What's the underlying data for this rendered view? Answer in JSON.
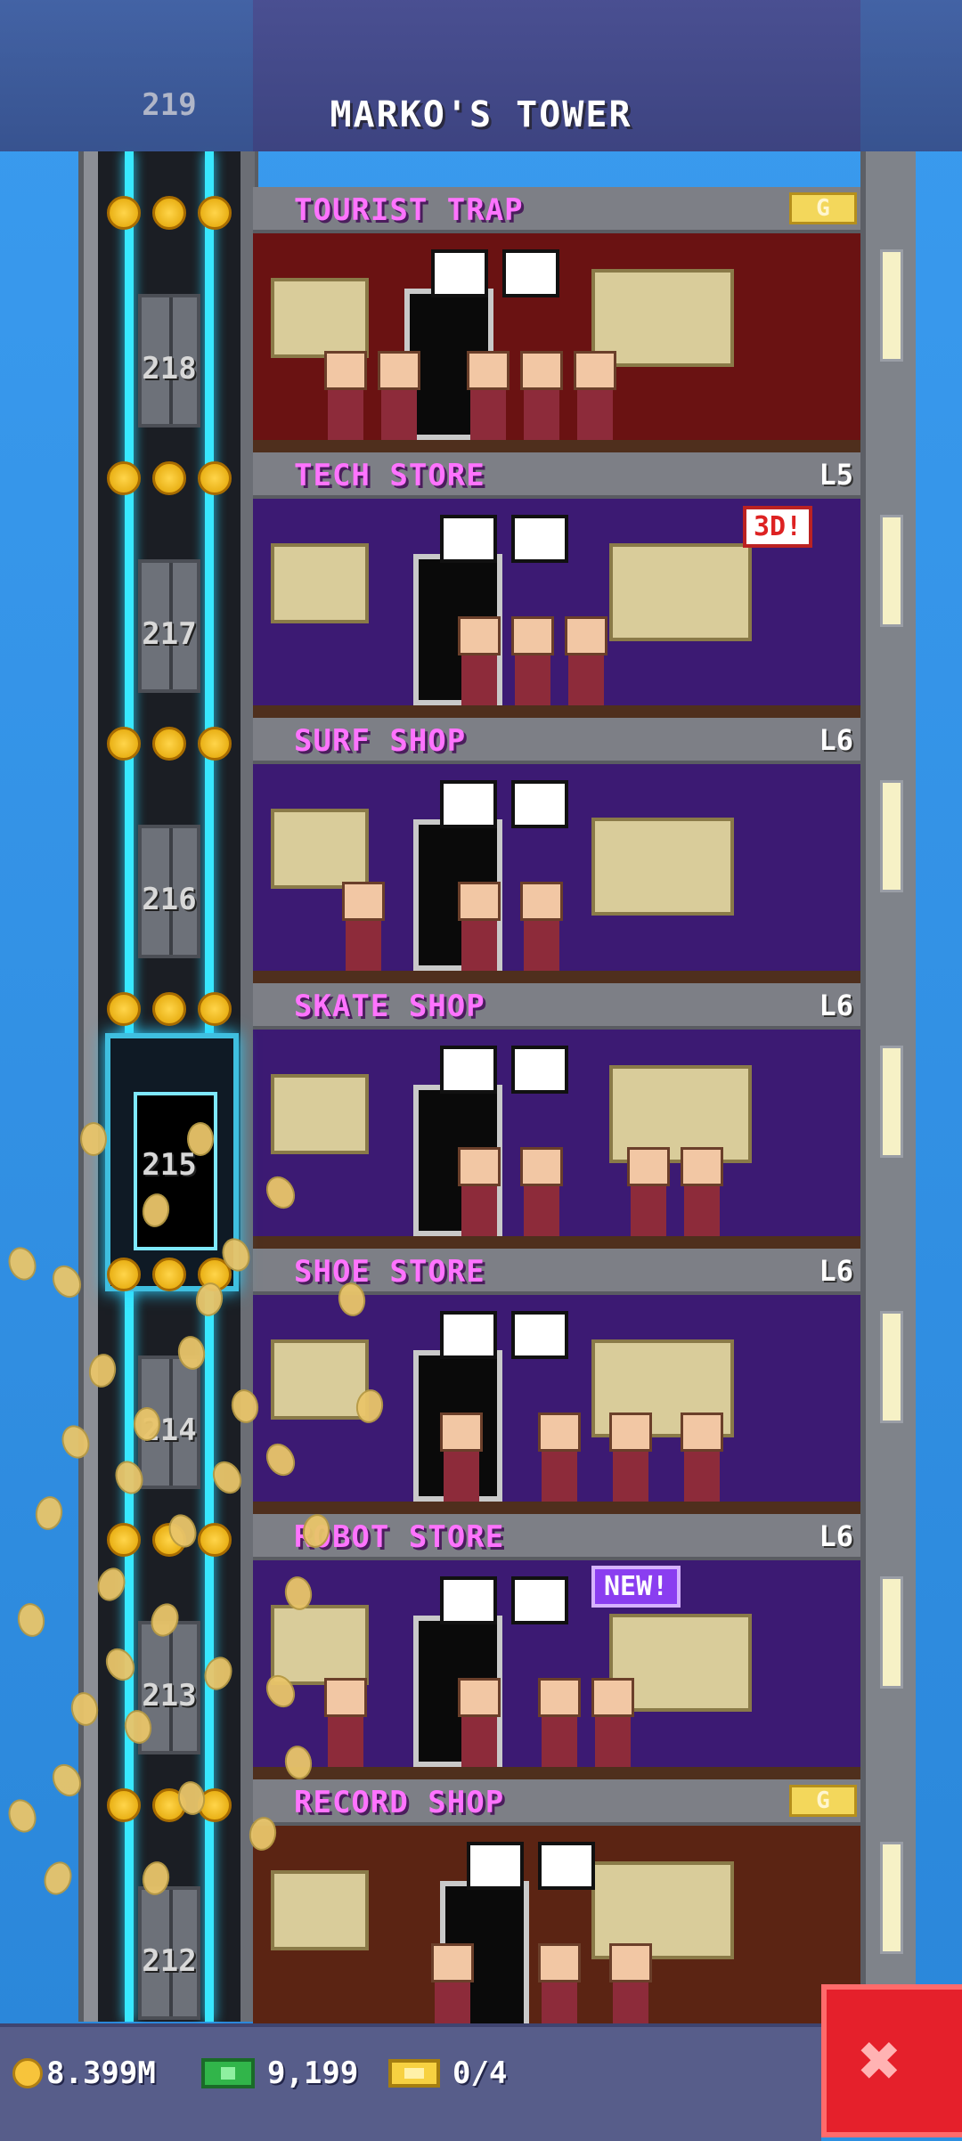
{
  "header": {
    "title": "MARKO'S TOWER",
    "top_floor_number": "219"
  },
  "floors": [
    {
      "number": "218",
      "name": "TOURIST TRAP",
      "level": "G",
      "level_is_gold": true,
      "theme": "red"
    },
    {
      "number": "217",
      "name": "TECH STORE",
      "level": "L5",
      "level_is_gold": false,
      "theme": "purple"
    },
    {
      "number": "216",
      "name": "SURF SHOP",
      "level": "L6",
      "level_is_gold": false,
      "theme": "purple"
    },
    {
      "number": "215",
      "name": "SKATE SHOP",
      "level": "L6",
      "level_is_gold": false,
      "theme": "purple"
    },
    {
      "number": "214",
      "name": "SHOE STORE",
      "level": "L6",
      "level_is_gold": false,
      "theme": "purple"
    },
    {
      "number": "213",
      "name": "ROBOT STORE",
      "level": "L6",
      "level_is_gold": false,
      "theme": "purple"
    },
    {
      "number": "212",
      "name": "RECORD SHOP",
      "level": "G",
      "level_is_gold": true,
      "theme": "brown"
    }
  ],
  "signs": {
    "tech_3d": "3D!",
    "robot_new": "NEW!"
  },
  "bottom_bar": {
    "coins": "8.399M",
    "bux": "9,199",
    "tickets": "0/4"
  },
  "colors": {
    "sky": "#2d8fe0",
    "floor_name": "#ff73ff",
    "close_button": "#e5202b"
  },
  "icons": {
    "close": "close-icon",
    "coin": "coin-icon",
    "bux": "bux-icon",
    "ticket": "ticket-icon"
  }
}
